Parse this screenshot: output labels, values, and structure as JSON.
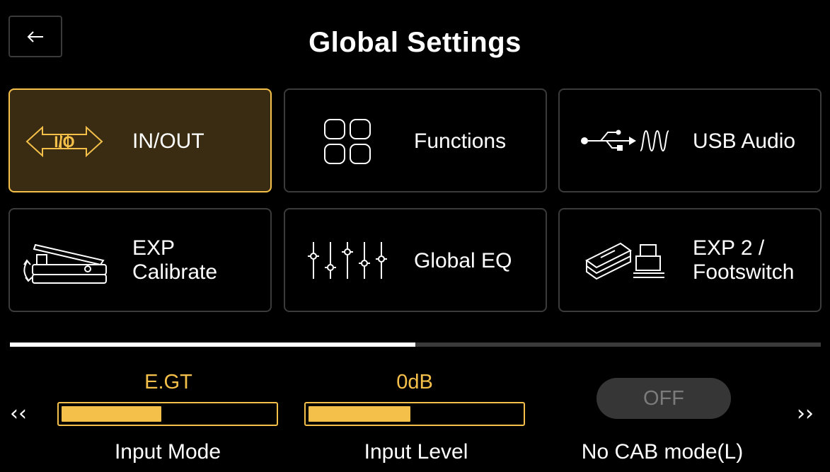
{
  "header": {
    "title": "Global Settings",
    "back_icon": "arrow-left-icon"
  },
  "tiles": [
    {
      "label": "IN/OUT",
      "icon": "io-arrows-icon",
      "active": true
    },
    {
      "label": "Functions",
      "icon": "grid-icon",
      "active": false
    },
    {
      "label": "USB Audio",
      "icon": "usb-audio-icon",
      "active": false
    },
    {
      "label": "EXP\nCalibrate",
      "icon": "expression-pedal-icon",
      "active": false
    },
    {
      "label": "Global EQ",
      "icon": "eq-sliders-icon",
      "active": false
    },
    {
      "label": "EXP 2 /\nFootswitch",
      "icon": "pedal-footswitch-icon",
      "active": false
    }
  ],
  "page_progress": 0.5,
  "params": {
    "prev_arrow": "‹‹",
    "next_arrow": "››",
    "input_mode": {
      "value": "E.GT",
      "label": "Input Mode",
      "level": 0.47
    },
    "input_level": {
      "value": "0dB",
      "label": "Input Level",
      "level": 0.48
    },
    "no_cab": {
      "value": "OFF",
      "label": "No CAB mode(L)"
    }
  },
  "colors": {
    "accent": "#f5c049",
    "active_bg": "#3a2c12",
    "border": "#3b3b3b"
  }
}
